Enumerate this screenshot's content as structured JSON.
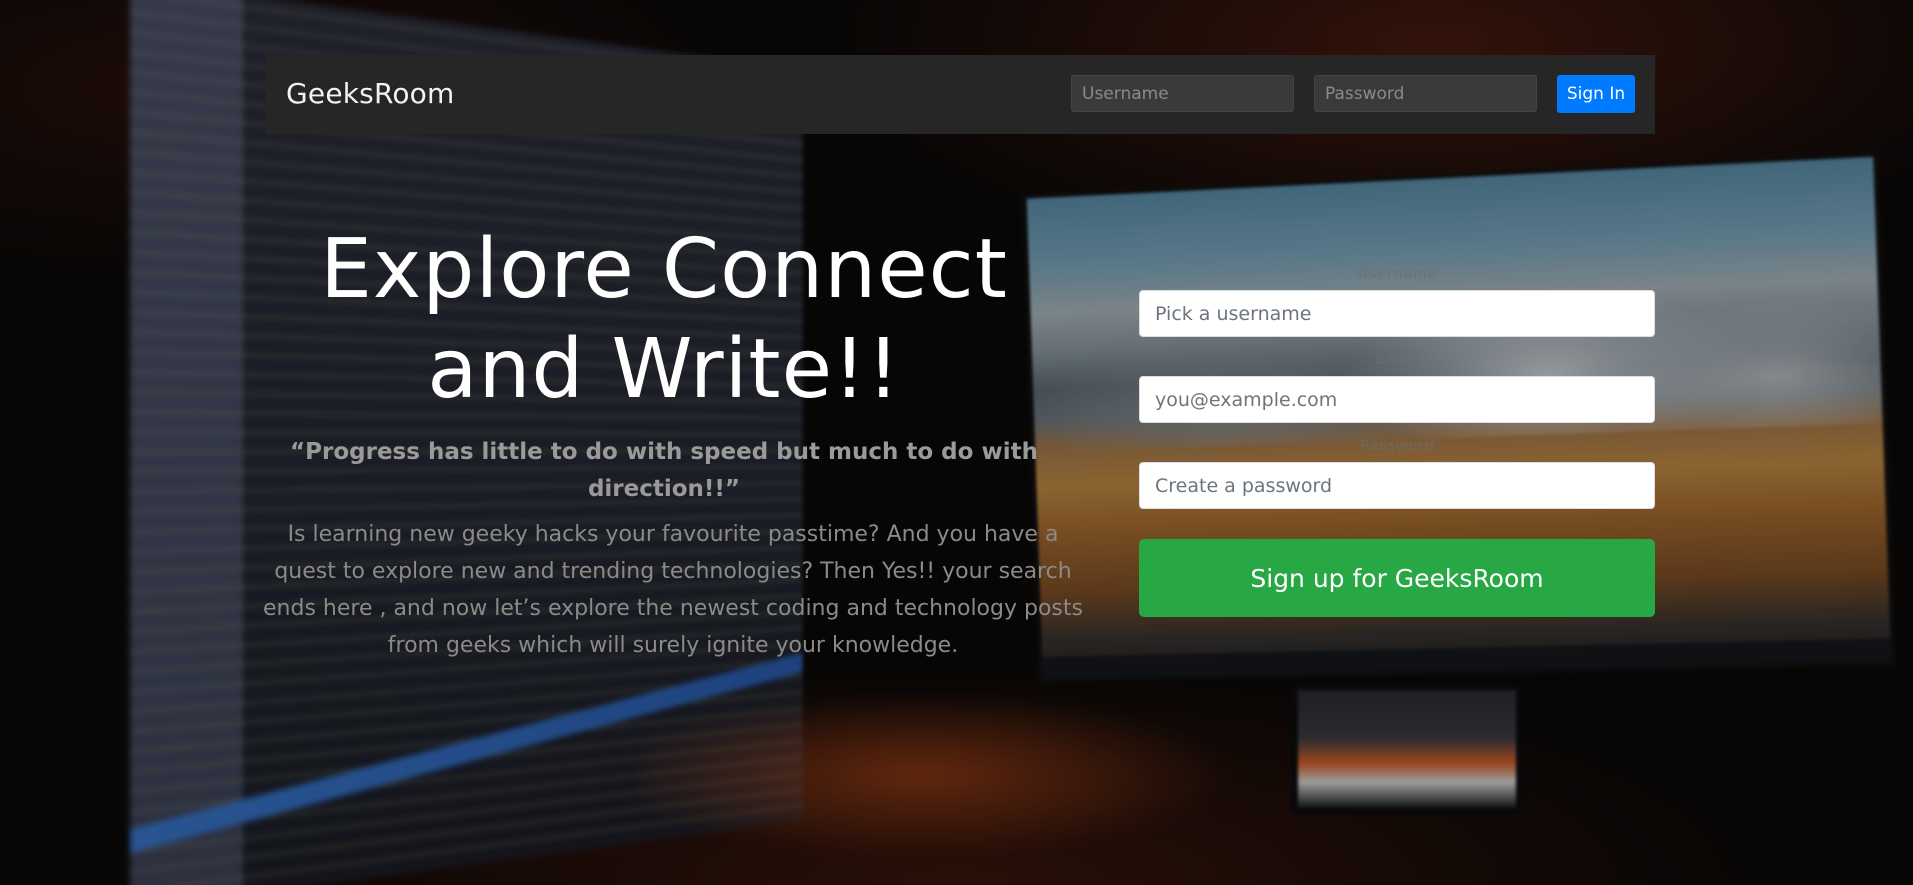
{
  "navbar": {
    "brand": "GeeksRoom",
    "username_placeholder": "Username",
    "password_placeholder": "Password",
    "signin_label": "Sign In"
  },
  "hero": {
    "title_line1": "Explore Connect",
    "title_line2": "and Write!!",
    "quote": "“Progress has little to do with speed but much to do with direction!!”",
    "description": "Is learning new geeky hacks your favourite passtime? And you have a quest to explore new and trending technologies? Then Yes!! your search ends here , and now let’s explore the newest coding and technology posts from geeks which will surely ignite your knowledge."
  },
  "signup": {
    "username_label": "Username",
    "username_placeholder": "Pick a username",
    "email_label": "Email",
    "email_placeholder": "you@example.com",
    "password_label": "Password",
    "password_placeholder": "Create a password",
    "submit_label": "Sign up for GeeksRoom"
  },
  "colors": {
    "navbar_bg": "#262626",
    "signin_button": "#007bff",
    "signup_button": "#28a745"
  }
}
